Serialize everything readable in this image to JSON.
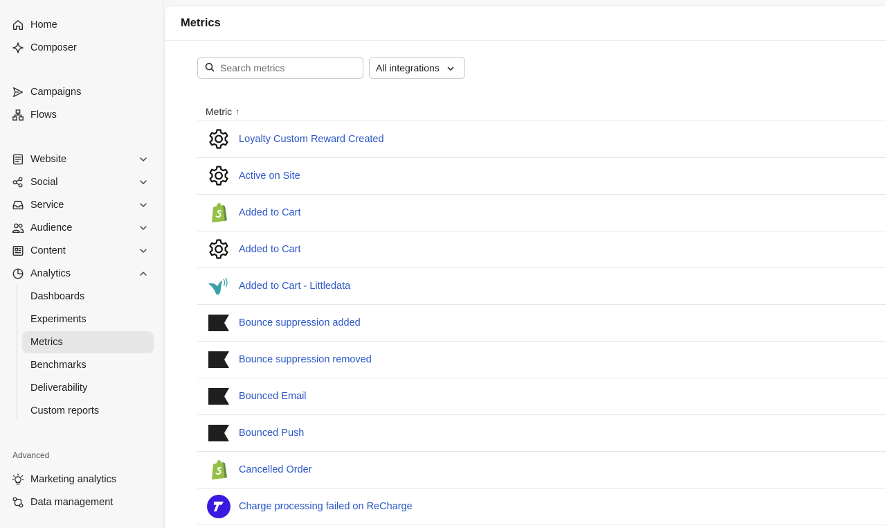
{
  "sidebar": {
    "nav_primary": [
      {
        "label": "Home",
        "icon": "home-icon"
      },
      {
        "label": "Composer",
        "icon": "sparkle-icon"
      }
    ],
    "nav_secondary": [
      {
        "label": "Campaigns",
        "icon": "send-icon"
      },
      {
        "label": "Flows",
        "icon": "flows-icon"
      }
    ],
    "nav_groups": [
      {
        "label": "Website",
        "icon": "website-icon",
        "expanded": false
      },
      {
        "label": "Social",
        "icon": "social-icon",
        "expanded": false
      },
      {
        "label": "Service",
        "icon": "inbox-icon",
        "expanded": false
      },
      {
        "label": "Audience",
        "icon": "users-icon",
        "expanded": false
      },
      {
        "label": "Content",
        "icon": "content-icon",
        "expanded": false
      },
      {
        "label": "Analytics",
        "icon": "pie-chart-icon",
        "expanded": true
      }
    ],
    "analytics_items": [
      "Dashboards",
      "Experiments",
      "Metrics",
      "Benchmarks",
      "Deliverability",
      "Custom reports"
    ],
    "active_item": "Metrics",
    "advanced_label": "Advanced",
    "advanced_items": [
      {
        "label": "Marketing analytics",
        "icon": "lightbulb-icon"
      },
      {
        "label": "Data management",
        "icon": "data-icon"
      }
    ]
  },
  "page": {
    "title": "Metrics",
    "search_placeholder": "Search metrics",
    "filter_label": "All integrations",
    "column_header": "Metric",
    "sort_indicator": "↑"
  },
  "metrics": [
    {
      "name": "Loyalty Custom Reward Created",
      "integration": "gear-icon"
    },
    {
      "name": "Active on Site",
      "integration": "gear-icon"
    },
    {
      "name": "Added to Cart",
      "integration": "shopify-icon"
    },
    {
      "name": "Added to Cart",
      "integration": "gear-icon"
    },
    {
      "name": "Added to Cart - Littledata",
      "integration": "littledata-icon"
    },
    {
      "name": "Bounce suppression added",
      "integration": "klaviyo-flag-icon"
    },
    {
      "name": "Bounce suppression removed",
      "integration": "klaviyo-flag-icon"
    },
    {
      "name": "Bounced Email",
      "integration": "klaviyo-flag-icon"
    },
    {
      "name": "Bounced Push",
      "integration": "klaviyo-flag-icon"
    },
    {
      "name": "Cancelled Order",
      "integration": "shopify-icon"
    },
    {
      "name": "Charge processing failed on ReCharge",
      "integration": "recharge-icon"
    }
  ],
  "colors": {
    "link": "#2b57c8",
    "shopify_green": "#95bf47",
    "recharge_purple": "#3a1ae0",
    "littledata_teal": "#3a9fa8"
  }
}
